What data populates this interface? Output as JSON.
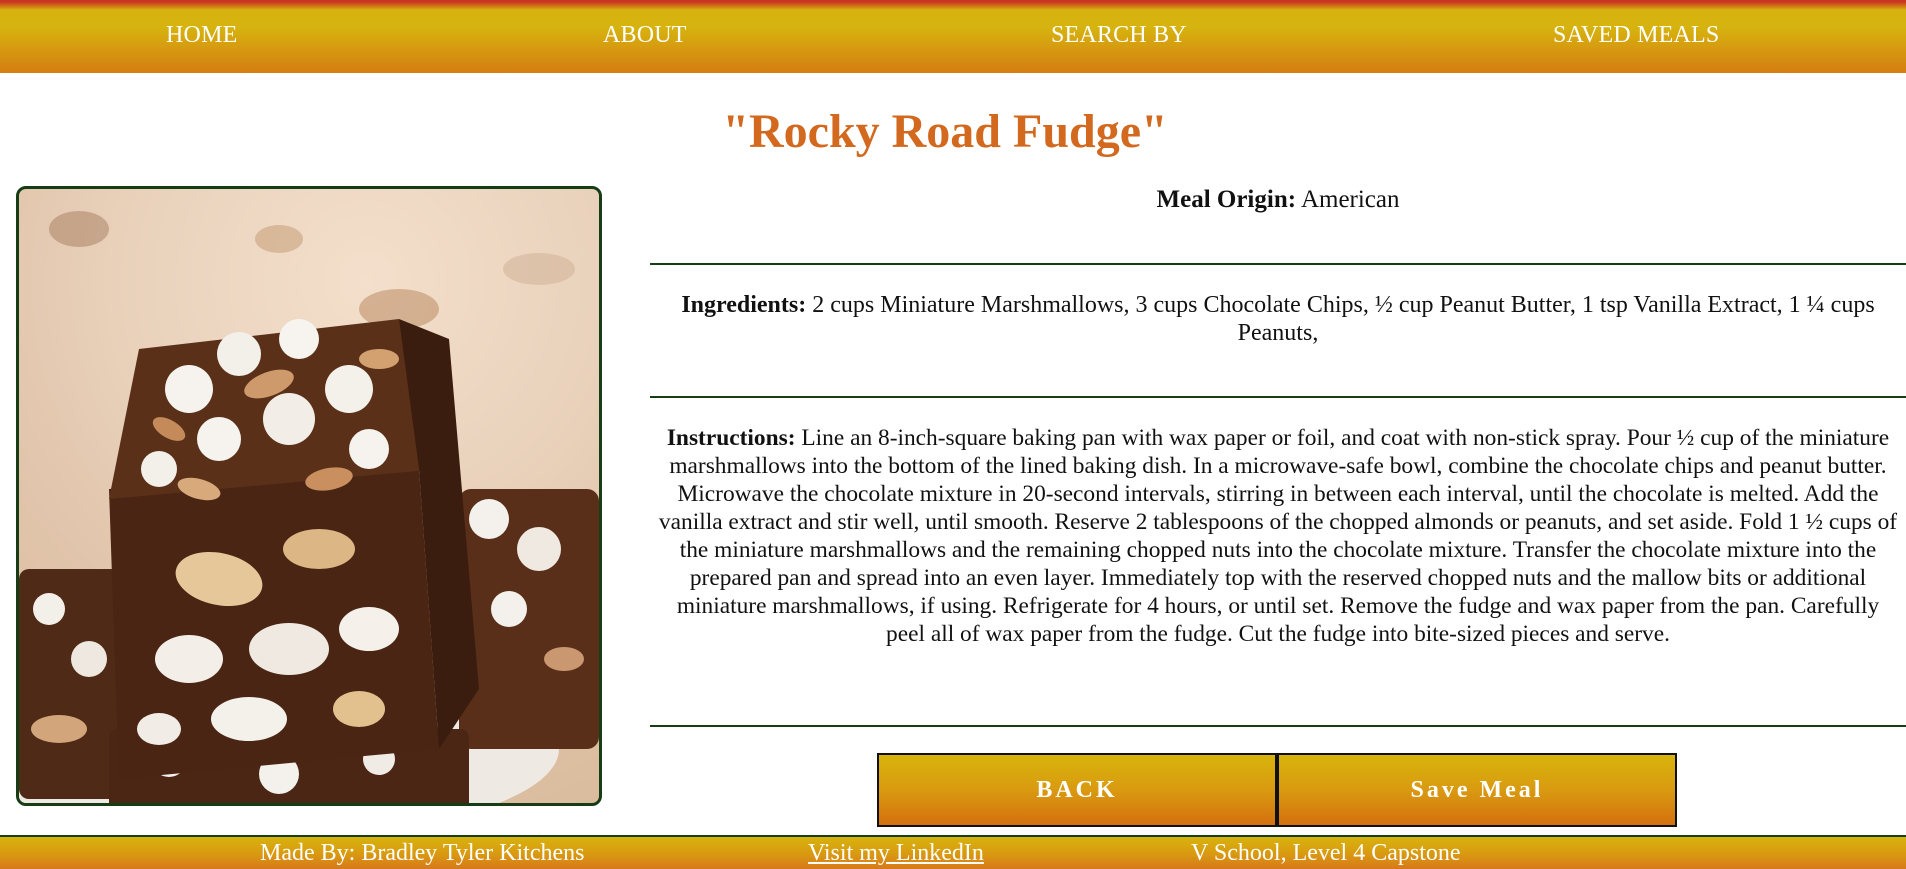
{
  "nav": {
    "home": "HOME",
    "about": "ABOUT",
    "search_by": "SEARCH BY",
    "saved_meals": "SAVED MEALS"
  },
  "meal": {
    "title": "\"Rocky Road Fudge\"",
    "origin_label": "Meal Origin:",
    "origin_value": "American",
    "ingredients_label": "Ingredients:",
    "ingredients_value": "2 cups Miniature Marshmallows, 3 cups Chocolate Chips, ½ cup Peanut Butter, 1 tsp Vanilla Extract, 1 ¼ cups Peanuts,",
    "instructions_label": "Instructions:",
    "instructions_value": "Line an 8-inch-square baking pan with wax paper or foil, and coat with non-stick spray. Pour ½ cup of the miniature marshmallows into the bottom of the lined baking dish. In a microwave-safe bowl, combine the chocolate chips and peanut butter. Microwave the chocolate mixture in 20-second intervals, stirring in between each interval, until the chocolate is melted. Add the vanilla extract and stir well, until smooth. Reserve 2 tablespoons of the chopped almonds or peanuts, and set aside. Fold 1 ½ cups of the miniature marshmallows and the remaining chopped nuts into the chocolate mixture. Transfer the chocolate mixture into the prepared pan and spread into an even layer. Immediately top with the reserved chopped nuts and the mallow bits or additional miniature marshmallows, if using. Refrigerate for 4 hours, or until set. Remove the fudge and wax paper from the pan. Carefully peel all of wax paper from the fudge. Cut the fudge into bite-sized pieces and serve."
  },
  "buttons": {
    "back": "BACK",
    "save": "Save Meal"
  },
  "footer": {
    "made_by": "Made By: Bradley Tyler Kitchens",
    "linkedin": "Visit my LinkedIn",
    "school": "V School, Level 4 Capstone"
  },
  "colors": {
    "title": "#d2691e",
    "rule": "#173d17",
    "gold": "#d6b30e",
    "orange": "#d4700f"
  }
}
